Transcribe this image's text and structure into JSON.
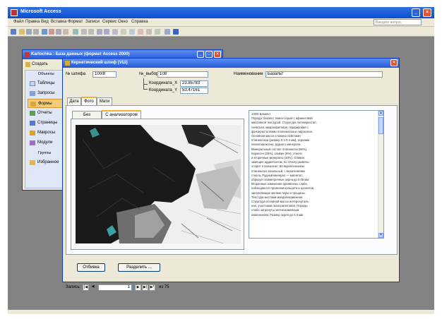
{
  "app": {
    "title": "Microsoft Access",
    "help_placeholder": "Введите вопрос"
  },
  "menu": [
    "Файл",
    "Правка",
    "Вид",
    "Вставка",
    "Формат",
    "Записи",
    "Сервис",
    "Окно",
    "Справка"
  ],
  "db_window": {
    "title": "Kartochka : База данных (формат Access 2000)",
    "create_label": "Создать",
    "objects_header": "Объекты",
    "items": [
      "Таблицы",
      "Запросы",
      "Формы",
      "Отчеты",
      "Страницы",
      "Макросы",
      "Модули"
    ],
    "groups_header": "Группы",
    "groups_items": [
      "Избранное"
    ]
  },
  "form": {
    "title": "Кернетический шлиф (VШ)",
    "labels": {
      "n_shlif": "№ шлифа",
      "n_vyb": "№_выбор",
      "coord_x": "Координата_X",
      "coord_y": "Координата_Y",
      "name": "Наименование"
    },
    "values": {
      "n_shlif": "100/8",
      "n_vyb": "108",
      "coord_x": "23.85783",
      "coord_y": "53.47161",
      "name": "Базальт"
    },
    "tabs": [
      "Дата",
      "Фото",
      "Мати"
    ],
    "sub_tabs": [
      "Без анализатора",
      "С анализатором"
    ],
    "description": [
      "100/8 Базальт",
      "Порода: базальт темно-серый с афанитовой",
      "массивной текстурой. Структура полнокристал-",
      "лическая, микроофитовая, порфировая с",
      "фенокристаллами плагиоклаза и пироксена.",
      "Основная масса сложена лейстами",
      "плагиоклаза (размер 0.1-0.3 мм), зернами",
      "клинопироксена, рудного минерала.",
      "Минеральный состав: плагиоклаз (55%),",
      "пироксен (30%), оливин (5%), стекло",
      "и вторичные минералы (10%). Оливин",
      "замещен иддингситом, по стеклу развиты",
      "хлорит и палагонит. Во вкрапленниках",
      "плагиоклаз зональный, с включениями",
      "стекла. Рудный минерал — магнетит,",
      "образует изометричные зерна до 0.05 мм.",
      "Вторичные изменения проявлены слабо,",
      "наблюдаются прожилки кальцита и цеолитов,",
      "заполняющие мелкие поры и трещины.",
      "Текстура местами миндалекаменная.",
      "Структура основной массы интерсерталь-",
      "ная, участками гиалопилитовая. Породы",
      "слабо затронуты зеленокаменным",
      "изменением. Размер зерен до 0.3 мм."
    ],
    "buttons": {
      "left": "Отбивка",
      "right": "Разделить ..."
    },
    "record_nav": {
      "label": "Запись:",
      "current": "1",
      "of_text": "из 75"
    }
  },
  "colors": {
    "desktop": "#828282",
    "title_blue": "#0a4fd1",
    "panel": "#ece9d8",
    "close_red": "#e0542e"
  }
}
